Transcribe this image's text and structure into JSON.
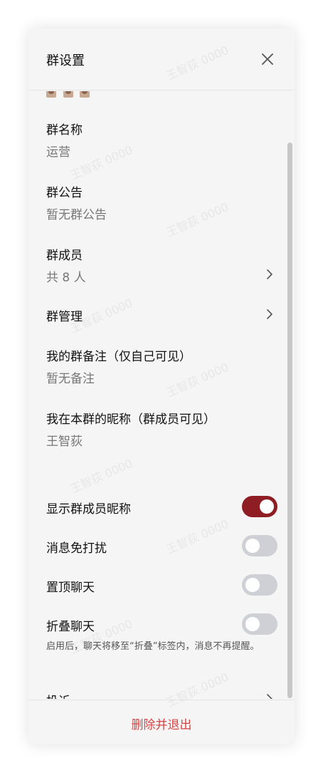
{
  "header": {
    "title": "群设置"
  },
  "settings": {
    "group_name": {
      "label": "群名称",
      "value": "运营"
    },
    "announcement": {
      "label": "群公告",
      "value": "暂无群公告"
    },
    "members": {
      "label": "群成员",
      "value": "共 8 人"
    },
    "management": {
      "label": "群管理"
    },
    "my_remark": {
      "label": "我的群备注（仅自己可见）",
      "value": "暂无备注"
    },
    "my_nickname": {
      "label": "我在本群的昵称（群成员可见）",
      "value": "王智荻"
    },
    "show_nicknames": {
      "label": "显示群成员昵称",
      "enabled": true
    },
    "mute": {
      "label": "消息免打扰",
      "enabled": false
    },
    "pin": {
      "label": "置顶聊天",
      "enabled": false
    },
    "fold": {
      "label": "折叠聊天",
      "enabled": false,
      "hint": "启用后，聊天将移至“折叠”标签内，消息不再提醒。"
    },
    "report": {
      "label": "投诉"
    }
  },
  "footer": {
    "delete_label": "删除并退出"
  },
  "watermark": "王智荻 0000",
  "colors": {
    "toggle_on": "#8e1e24",
    "toggle_off": "#cfd0d5",
    "danger": "#d64545"
  }
}
